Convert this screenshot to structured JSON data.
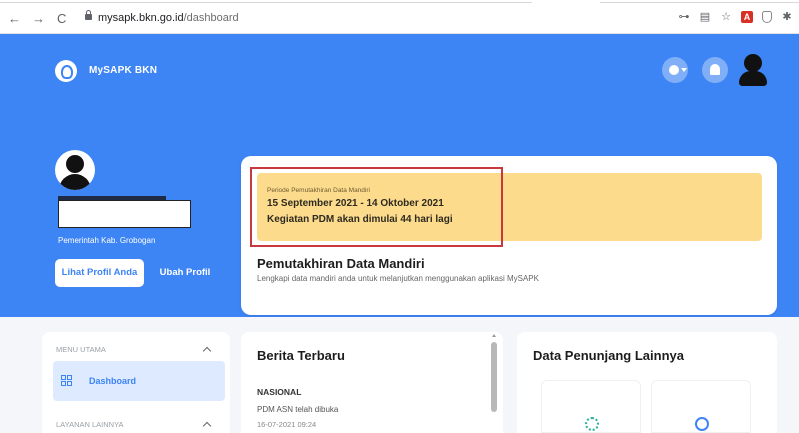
{
  "browser": {
    "back_glyph": "←",
    "forward_glyph": "→",
    "reload_glyph": "C",
    "url_host": "mysapk.bkn.go.id",
    "url_path": "/dashboard",
    "ext_key_glyph": "⊶",
    "ext_translate_glyph": "▤",
    "ext_star_glyph": "☆",
    "ext_pdf_glyph": "A",
    "ext_puzzle_glyph": "✱"
  },
  "header": {
    "brand": "MySAPK BKN"
  },
  "profile": {
    "agency": "Pemerintah Kab. Grobogan",
    "view_profile_label": "Lihat Profil Anda",
    "edit_profile_label": "Ubah Profil"
  },
  "pdm_card": {
    "period_caption": "Periode Pemutakhiran Data Mandiri",
    "period_dates": "15 September 2021 - 14 Oktober 2021",
    "countdown": "Kegiatan PDM akan dimulai 44 hari lagi",
    "title": "Pemutakhiran Data Mandiri",
    "subtitle": "Lengkapi data mandiri anda untuk melanjutkan menggunakan aplikasi MySAPK",
    "notice_color": "#fcdc8c",
    "highlight_color": "#c8383d"
  },
  "menu": {
    "main_heading": "MENU UTAMA",
    "dashboard_label": "Dashboard",
    "other_heading": "LAYANAN LAINNYA"
  },
  "news": {
    "title": "Berita Terbaru",
    "category": "NASIONAL",
    "headline": "PDM ASN telah dibuka",
    "date": "16-07-2021 09:24"
  },
  "support": {
    "title": "Data Penunjang Lainnya"
  },
  "colors": {
    "brand_blue": "#3d84f5",
    "page_bg": "#f4f6f9"
  }
}
